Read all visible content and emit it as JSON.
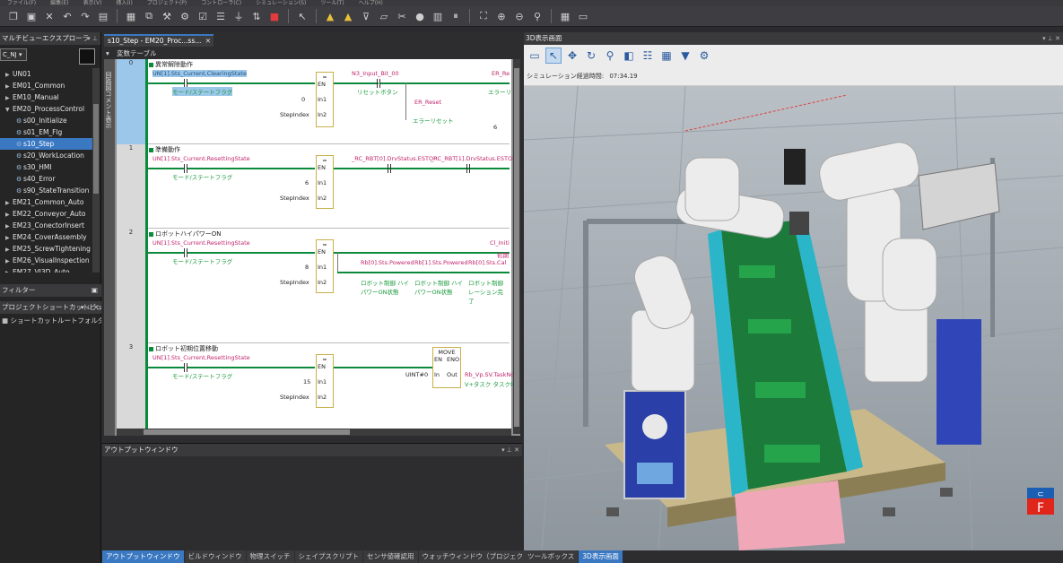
{
  "menubar": [
    "ファイル(F)",
    "編集(E)",
    "表示(V)",
    "挿入(I)",
    "プロジェクト(P)",
    "コントローラ(C)",
    "シミュレーション(S)",
    "ツール(T)",
    "ヘルプ(H)"
  ],
  "left_panel": {
    "title": "マルチビューエクスプローラ",
    "controller": "C_NJ",
    "tree": [
      {
        "label": "UN01",
        "level": 1,
        "kind": "folder"
      },
      {
        "label": "EM01_Common",
        "level": 1,
        "kind": "folder"
      },
      {
        "label": "EM10_Manual",
        "level": 1,
        "kind": "folder"
      },
      {
        "label": "EM20_ProcessControl",
        "level": 1,
        "kind": "folder-open"
      },
      {
        "label": "s00_Initialize",
        "level": 2,
        "kind": "program"
      },
      {
        "label": "s01_EM_Flg",
        "level": 2,
        "kind": "program"
      },
      {
        "label": "s10_Step",
        "level": 2,
        "kind": "program",
        "selected": true
      },
      {
        "label": "s20_WorkLocation",
        "level": 2,
        "kind": "program"
      },
      {
        "label": "s30_HMI",
        "level": 2,
        "kind": "program"
      },
      {
        "label": "s40_Error",
        "level": 2,
        "kind": "program"
      },
      {
        "label": "s90_StateTransition",
        "level": 2,
        "kind": "program"
      },
      {
        "label": "EM21_Common_Auto",
        "level": 1,
        "kind": "folder"
      },
      {
        "label": "EM22_Conveyor_Auto",
        "level": 1,
        "kind": "folder"
      },
      {
        "label": "EM23_ConectorInsert",
        "level": 1,
        "kind": "folder"
      },
      {
        "label": "EM24_CoverAssembly",
        "level": 1,
        "kind": "folder"
      },
      {
        "label": "EM25_ScrewTightening",
        "level": 1,
        "kind": "folder"
      },
      {
        "label": "EM26_VisualInspection",
        "level": 1,
        "kind": "folder"
      },
      {
        "label": "EM27_VI3D_Auto",
        "level": 1,
        "kind": "folder"
      }
    ],
    "filter_label": "フィルター",
    "shortcut_title": "プロジェクトショートカットビュー",
    "shortcut_item": "ショートカットルートフォルダ"
  },
  "editor": {
    "tab_label": "s10_Step - EM20_Proc...ss...",
    "var_table_label": "変数テーブル",
    "side_label": "回路図コメント表示",
    "rungs": [
      {
        "num": "0",
        "title": "異常解除動作",
        "contact_var": "UN[1].Sts_Current.ClearingState",
        "contact_cmt": "モード/ステートフラグ",
        "block_fn": "=",
        "pins": [
          "EN",
          "In1",
          "In2"
        ],
        "in1_value": "0",
        "in2_var": "StepIndex",
        "extra_vars": [
          "N3_Input_Bit_00",
          "ER_Reset",
          "ER_Re"
        ],
        "extra_cmts": [
          "リセットボタン",
          "エラーリセット",
          "エラーリ"
        ],
        "right_value": "6"
      },
      {
        "num": "1",
        "title": "準備動作",
        "contact_var": "UN[1].Sts_Current.ResettingState",
        "contact_cmt": "モード/ステートフラグ",
        "block_fn": "=",
        "pins": [
          "EN",
          "In1",
          "In2"
        ],
        "in1_value": "6",
        "in2_var": "StepIndex",
        "extra_vars": [
          "_RC_RBT[0].DrvStatus.ESTOP",
          "_RC_RBT[1].DrvStatus.ESTOP"
        ]
      },
      {
        "num": "2",
        "title": "ロボットハイパワーON",
        "contact_var": "UN[1].Sts_Current.ResettingState",
        "contact_cmt": "モード/ステートフラグ",
        "block_fn": "=",
        "pins": [
          "EN",
          "In1",
          "In2"
        ],
        "in1_value": "8",
        "in2_var": "StepIndex",
        "extra_vars": [
          "Rb[0].Sts.Powered",
          "Rb[1].Sts.Powered",
          "Rb[0].Sts.Cal",
          "Cl_Initi",
          "初期"
        ],
        "extra_cmts": [
          "ロボット制御 ハイパワーON状態",
          "ロボット制御 ハイパワーON状態",
          "ロボット制御 レーション完了"
        ]
      },
      {
        "num": "3",
        "title": "ロボット初期位置移動",
        "contact_var": "UN[1].Sts_Current.ResettingState",
        "contact_cmt": "モード/ステートフラグ",
        "block_fn": "=",
        "pins": [
          "EN",
          "In1",
          "In2"
        ],
        "in1_value": "15",
        "in2_var": "StepIndex",
        "move_block": {
          "fn": "MOVE",
          "pins": [
            "EN",
            "ENO",
            "In",
            "Out"
          ],
          "in_value": "UINT#0",
          "out_var": "Rb_Vp.SV.TaskNo",
          "out_cmt": "V+タスク タスクNo"
        }
      }
    ]
  },
  "output": {
    "title": "アウトプットウィンドウ",
    "tabs": [
      "アウトプットウィンドウ",
      "ビルドウィンドウ",
      "物理スイッチ",
      "シェイプスクリプト",
      "センサ値確認用",
      "ウォッチウィンドウ（プロジェクト）1"
    ]
  },
  "view3d": {
    "title": "3D表示画面",
    "sim_time_label": "シミュレーション経過時間:",
    "sim_time_value": "07:34.19",
    "tabs": [
      "ツールボックス",
      "3D表示画面"
    ],
    "icons": [
      "view-icon",
      "select-icon",
      "move-icon",
      "rotate-icon",
      "zoom-icon",
      "box-icon",
      "list-icon",
      "grid-icon",
      "camera-icon",
      "robot-icon"
    ]
  },
  "colors": {
    "accent": "#3a78c2",
    "ladder_green": "#0c8a3c",
    "var_pink": "#c0246b",
    "comment_green": "#1a9a3c",
    "badge_red": "#e0251b",
    "badge_blue": "#1a5fb4"
  }
}
